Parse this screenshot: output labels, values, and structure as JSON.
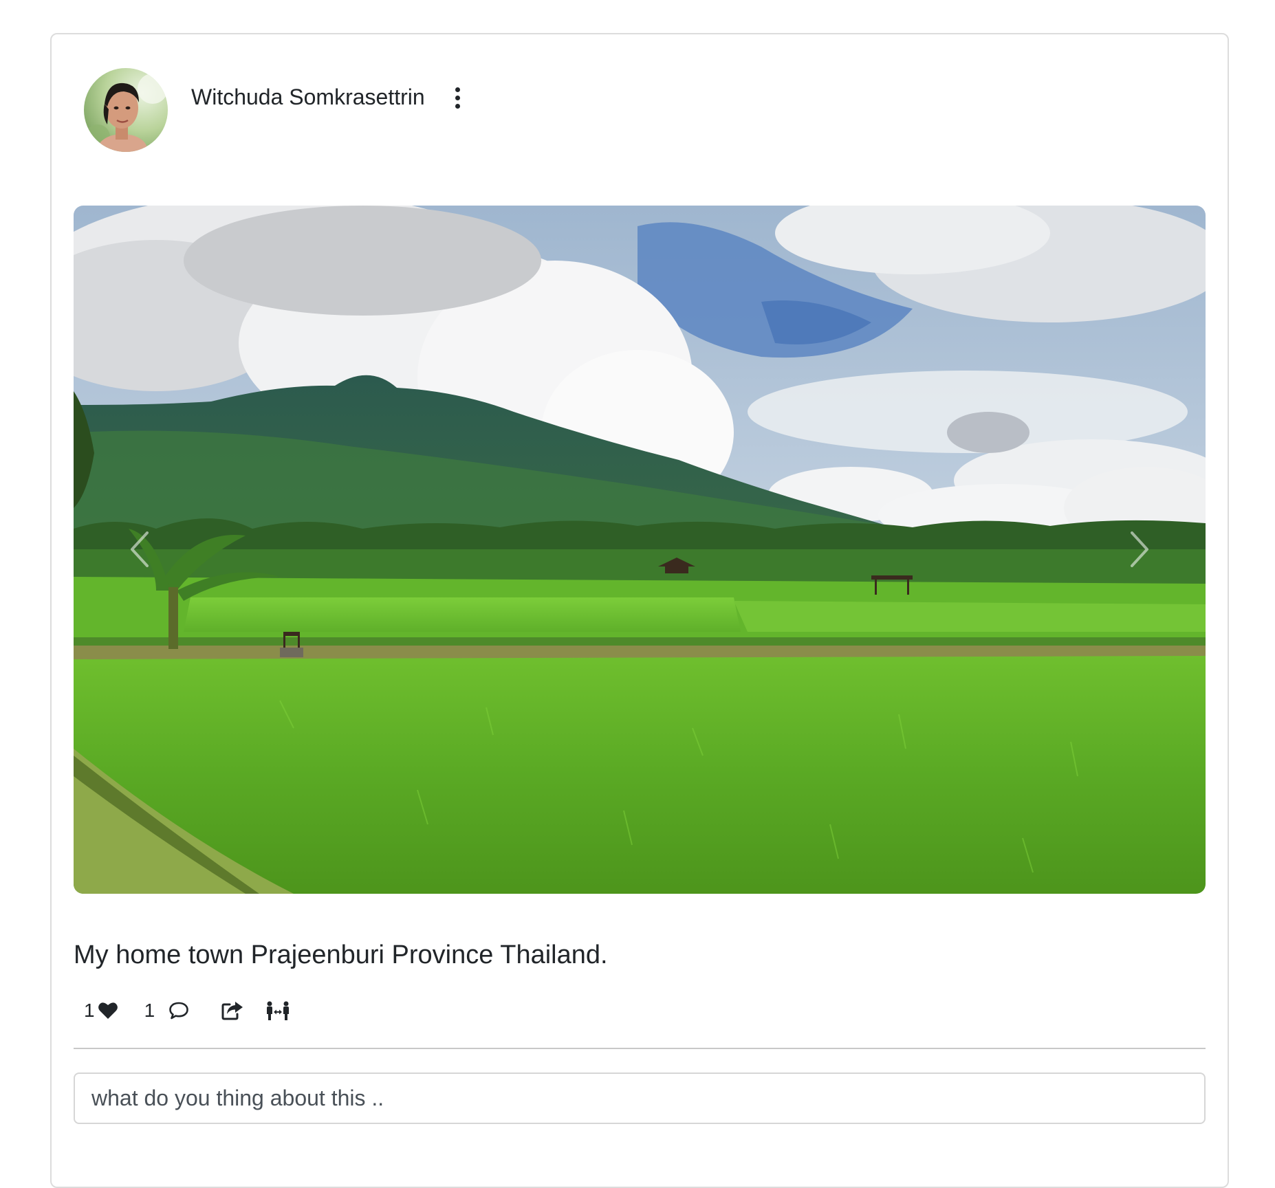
{
  "post": {
    "author": {
      "name": "Witchuda Somkrasettrin",
      "avatar_icon": "avatar-photo"
    },
    "more_icon": "vertical-ellipsis-icon",
    "carousel": {
      "prev_icon": "chevron-left-icon",
      "next_icon": "chevron-right-icon"
    },
    "caption": "My home town Prajeenburi Province Thailand.",
    "actions": {
      "likes_count": "1",
      "like_icon": "heart-icon",
      "comments_count": "1",
      "comment_icon": "speech-bubble-icon",
      "share_icon": "share-icon",
      "connect_icon": "people-arrows-icon"
    },
    "comment_box": {
      "placeholder": "what do you thing about this .."
    }
  },
  "colors": {
    "text": "#212529",
    "border": "#dcdcdc",
    "divider": "#c8c8c8"
  }
}
